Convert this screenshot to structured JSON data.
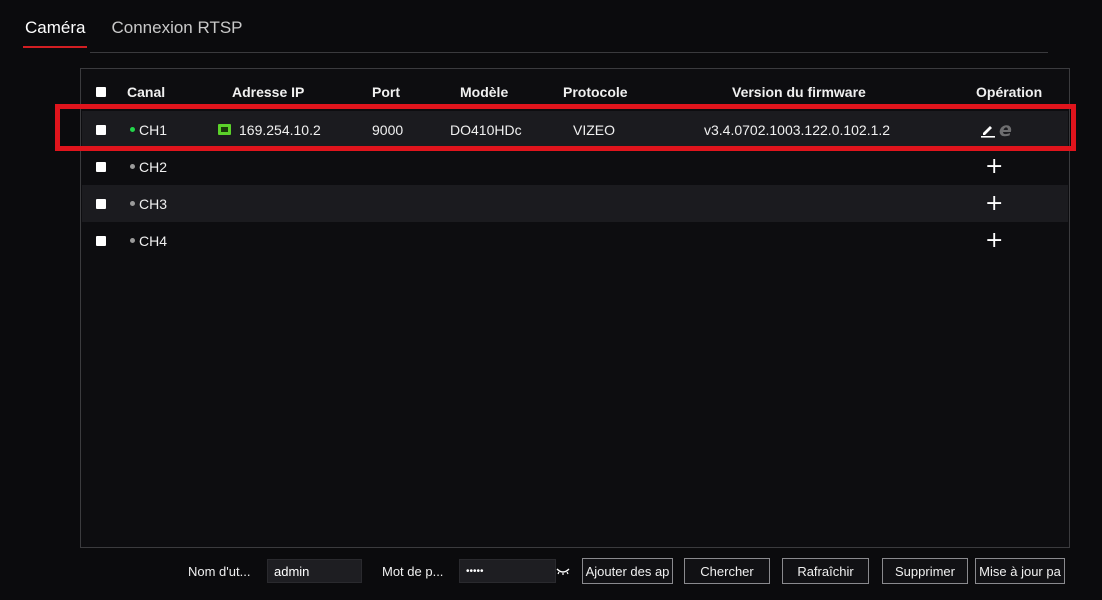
{
  "tabs": [
    {
      "label": "Caméra",
      "active": true
    },
    {
      "label": "Connexion RTSP",
      "active": false
    }
  ],
  "table": {
    "columns": {
      "canal": "Canal",
      "ip": "Adresse IP",
      "port": "Port",
      "model": "Modèle",
      "protocol": "Protocole",
      "firmware": "Version du firmware",
      "operation": "Opération"
    },
    "rows": [
      {
        "channel": "CH1",
        "status": "online",
        "ip": "169.254.10.2",
        "port": "9000",
        "model": "DO410HDc",
        "protocol": "VIZEO",
        "firmware": "v3.4.0702.1003.122.0.102.1.2"
      },
      {
        "channel": "CH2",
        "status": "offline",
        "ip": "",
        "port": "",
        "model": "",
        "protocol": "",
        "firmware": ""
      },
      {
        "channel": "CH3",
        "status": "offline",
        "ip": "",
        "port": "",
        "model": "",
        "protocol": "",
        "firmware": ""
      },
      {
        "channel": "CH4",
        "status": "offline",
        "ip": "",
        "port": "",
        "model": "",
        "protocol": "",
        "firmware": ""
      }
    ],
    "add_symbol": "+"
  },
  "bottom": {
    "username_label": "Nom d'ut...",
    "username_value": "admin",
    "password_label": "Mot de p...",
    "password_value": "•••••",
    "add_button": "Ajouter des ap",
    "search_button": "Chercher",
    "refresh_button": "Rafraîchir",
    "delete_button": "Supprimer",
    "update_button": "Mise à jour pa"
  },
  "colors": {
    "accent": "#d21e22",
    "highlight": "#e0141c",
    "online": "#22d64a",
    "offline": "#9a9a9a",
    "network_icon": "#5bd12a"
  }
}
